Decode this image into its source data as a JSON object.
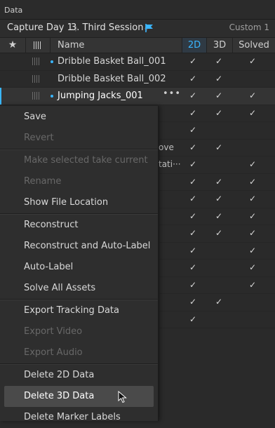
{
  "panel_title": "Data",
  "filter": {
    "capture_day": "Capture Day 1",
    "session": "3. Third Session",
    "custom_label": "Custom 1"
  },
  "columns": {
    "star": "★",
    "name": "Name",
    "c2d": "2D",
    "c3d": "3D",
    "solved": "Solved"
  },
  "rows": [
    {
      "name": "Dribble Basket Ball_001",
      "frag": "",
      "has_dot": true,
      "checks": [
        "✓",
        "✓",
        "✓"
      ]
    },
    {
      "name": "Dribble Basket Ball_002",
      "frag": "",
      "has_dot": false,
      "checks": [
        "✓",
        "✓",
        ""
      ]
    },
    {
      "name": "Jumping Jacks_001",
      "frag": "",
      "has_dot": true,
      "more": "•••",
      "checks": [
        "✓",
        "✓",
        "✓"
      ]
    },
    {
      "name": "",
      "frag": "",
      "checks": [
        "✓",
        "✓",
        "✓"
      ]
    },
    {
      "name": "",
      "frag": "",
      "checks": [
        "✓",
        "",
        ""
      ]
    },
    {
      "name": "",
      "frag": "ove",
      "checks": [
        "✓",
        "✓",
        ""
      ]
    },
    {
      "name": "",
      "frag": "tati···",
      "checks": [
        "✓",
        "",
        "✓"
      ]
    },
    {
      "name": "",
      "frag": "",
      "checks": [
        "✓",
        "✓",
        "✓"
      ]
    },
    {
      "name": "",
      "frag": "",
      "checks": [
        "✓",
        "✓",
        "✓"
      ]
    },
    {
      "name": "",
      "frag": "",
      "checks": [
        "✓",
        "✓",
        "✓"
      ]
    },
    {
      "name": "",
      "frag": "",
      "checks": [
        "✓",
        "✓",
        "✓"
      ]
    },
    {
      "name": "",
      "frag": "",
      "checks": [
        "✓",
        "",
        "✓"
      ]
    },
    {
      "name": "",
      "frag": "",
      "checks": [
        "✓",
        "",
        "✓"
      ]
    },
    {
      "name": "",
      "frag": "",
      "checks": [
        "✓",
        "",
        "✓"
      ]
    },
    {
      "name": "",
      "frag": "",
      "checks": [
        "✓",
        "✓",
        ""
      ]
    },
    {
      "name": "",
      "frag": "",
      "checks": [
        "✓",
        "",
        ""
      ]
    }
  ],
  "menu": {
    "save": "Save",
    "revert": "Revert",
    "make_current": "Make selected take current",
    "rename": "Rename",
    "show_file_location": "Show File Location",
    "reconstruct": "Reconstruct",
    "reconstruct_autolabel": "Reconstruct and Auto-Label",
    "autolabel": "Auto-Label",
    "solve_all": "Solve All Assets",
    "export_tracking": "Export Tracking Data",
    "export_video": "Export Video",
    "export_audio": "Export Audio",
    "delete_2d": "Delete 2D Data",
    "delete_3d": "Delete 3D Data",
    "delete_marker_labels": "Delete Marker Labels"
  },
  "colors": {
    "accent": "#3ab6ff",
    "background": "#2a2a2a",
    "menu": "#2e2e2e",
    "hover": "#4a4a4a"
  }
}
